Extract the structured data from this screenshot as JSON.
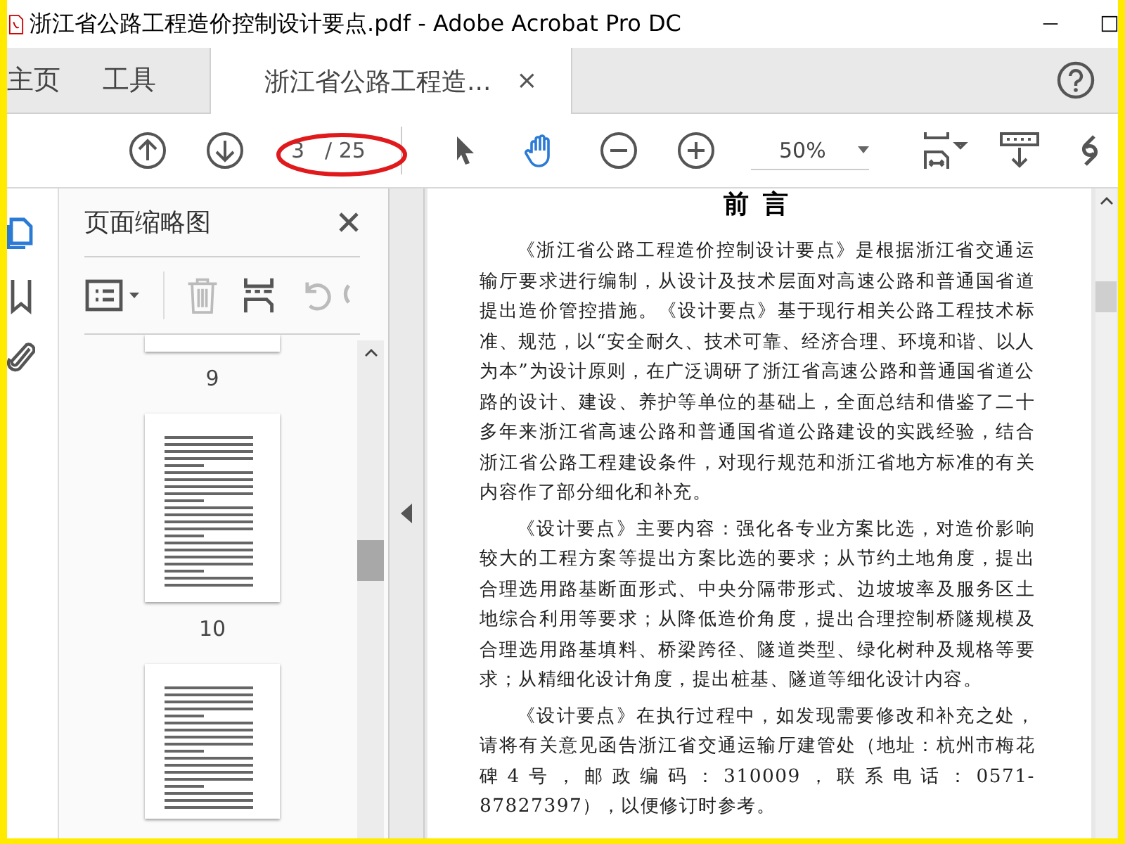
{
  "window": {
    "title": "浙江省公路工程造价控制设计要点.pdf - Adobe Acrobat Pro DC"
  },
  "tabs": [
    {
      "label": "主页",
      "selected": false
    },
    {
      "label": "工具",
      "selected": false
    },
    {
      "label": "浙江省公路工程造...",
      "selected": true,
      "close": "×"
    }
  ],
  "toolbar": {
    "page_current": "3",
    "page_total": "/ 25",
    "zoom": "50%"
  },
  "side_rail": [
    {
      "kind": "pages",
      "selected": true
    },
    {
      "kind": "bookmarks",
      "selected": false
    },
    {
      "kind": "attachments",
      "selected": false
    }
  ],
  "panel": {
    "title": "页面缩略图"
  },
  "thumbnails": [
    {
      "kind": "cut_top",
      "label": "9"
    },
    {
      "kind": "full",
      "label": "10"
    },
    {
      "kind": "cut_bottom"
    }
  ],
  "document": {
    "heading": "前 言",
    "paragraphs": [
      "《浙江省公路工程造价控制设计要点》是根据浙江省交通运输厅要求进行编制，从设计及技术层面对高速公路和普通国省道提出造价管控措施。《设计要点》基于现行相关公路工程技术标准、规范，以“安全耐久、技术可靠、经济合理、环境和谐、以人为本”为设计原则，在广泛调研了浙江省高速公路和普通国省道公路的设计、建设、养护等单位的基础上，全面总结和借鉴了二十多年来浙江省高速公路和普通国省道公路建设的实践经验，结合浙江省公路工程建设条件，对现行规范和浙江省地方标准的有关内容作了部分细化和补充。",
      "《设计要点》主要内容：强化各专业方案比选，对造价影响较大的工程方案等提出方案比选的要求；从节约土地角度，提出合理选用路基断面形式、中央分隔带形式、边坡坡率及服务区土地综合利用等要求；从降低造价角度，提出合理控制桥隧规模及合理选用路基填料、桥梁跨径、隧道类型、绿化树种及规格等要求；从精细化设计角度，提出桩基、隧道等细化设计内容。",
      "《设计要点》在执行过程中，如发现需要修改和补充之处，请将有关意见函告浙江省交通运输厅建管处（地址：杭州市梅花碑4号，邮政编码：310009，联系电话：0571-87827397），以便修订时参考。"
    ]
  }
}
